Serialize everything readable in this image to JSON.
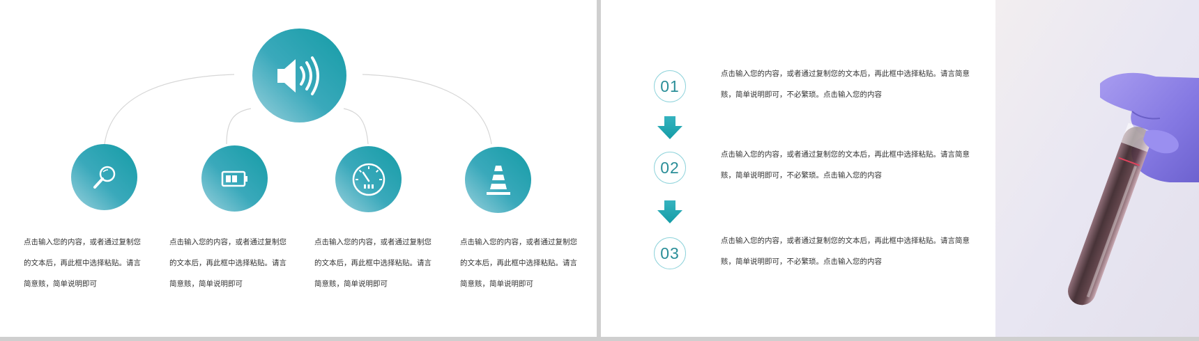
{
  "left_slide": {
    "main_icon": "speaker-volume-icon",
    "nodes": [
      {
        "icon": "magnifier-icon",
        "text": "点击输入您的内容，或者通过复制您的文本后，再此框中选择粘贴。请言简意赅，简单说明即可"
      },
      {
        "icon": "battery-icon",
        "text": "点击输入您的内容，或者通过复制您的文本后，再此框中选择粘贴。请言简意赅，简单说明即可"
      },
      {
        "icon": "speedometer-icon",
        "text": "点击输入您的内容，或者通过复制您的文本后，再此框中选择粘贴。请言简意赅，简单说明即可"
      },
      {
        "icon": "traffic-cone-icon",
        "text": "点击输入您的内容，或者通过复制您的文本后，再此框中选择粘贴。请言简意赅，简单说明即可"
      }
    ]
  },
  "right_slide": {
    "steps": [
      {
        "number": "01",
        "text": "点击输入您的内容，或者通过复制您的文本后，再此框中选择粘贴。请言简意赅，简单说明即可，不必繁琐。点击输入您的内容"
      },
      {
        "number": "02",
        "text": "点击输入您的内容，或者通过复制您的文本后，再此框中选择粘贴。请言简意赅，简单说明即可，不必繁琐。点击输入您的内容"
      },
      {
        "number": "03",
        "text": "点击输入您的内容，或者通过复制您的文本后，再此框中选择粘贴。请言简意赅，简单说明即可，不必繁琐。点击输入您的内容"
      }
    ],
    "arrow_icon": "down-arrow-icon",
    "photo": "gloved-hand-holding-test-tube"
  },
  "colors": {
    "accent": "#159ca6",
    "accent_light": "#9bd1dd",
    "glove": "#8d84e8",
    "text": "#333333",
    "frame": "#cfcfcf"
  }
}
